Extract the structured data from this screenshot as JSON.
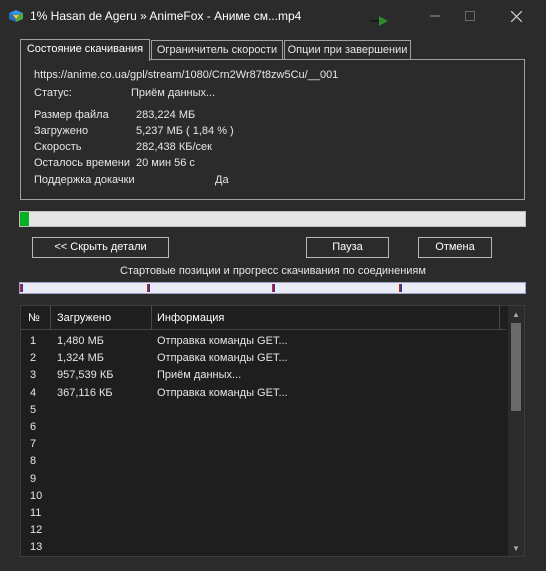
{
  "window": {
    "title": "1% Hasan de Ageru » AnimeFox - Аниме см...mp4",
    "minimize_icon": "minimize-icon",
    "maximize_icon": "maximize-icon",
    "close_icon": "close-icon"
  },
  "tabs": [
    {
      "label": "Состояние скачивания",
      "active": true
    },
    {
      "label": "Ограничитель скорости",
      "active": false
    },
    {
      "label": "Опции при завершении",
      "active": false
    }
  ],
  "details": {
    "url": "https://anime.co.ua/gpl/stream/1080/Crn2Wr87t8zw5Cu/__001",
    "status_label": "Статус:",
    "status_value": "Приём данных...",
    "file_size_label": "Размер файла",
    "file_size_value": "283,224  МБ",
    "downloaded_label": "Загружено",
    "downloaded_value": "5,237  МБ  ( 1,84 % )",
    "speed_label": "Скорость",
    "speed_value": "282,438  КБ/сек",
    "time_left_label": "Осталось времени",
    "time_left_value": "20 мин 56 с",
    "resume_label": "Поддержка докачки",
    "resume_value": "Да"
  },
  "progress": {
    "percent": 1.84,
    "fill_color": "#06b025"
  },
  "buttons": {
    "hide_details": "<< Скрыть детали",
    "pause": "Пауза",
    "cancel": "Отмена"
  },
  "connections": {
    "caption": "Стартовые позиции и прогресс скачивания по соединениям",
    "marker_color": "#cc2222"
  },
  "table": {
    "headers": [
      "№",
      "Загружено",
      "Информация"
    ],
    "rows": [
      {
        "n": "1",
        "downloaded": "1,480  МБ",
        "info": "Отправка команды GET..."
      },
      {
        "n": "2",
        "downloaded": "1,324  МБ",
        "info": "Отправка команды GET..."
      },
      {
        "n": "3",
        "downloaded": "957,539  КБ",
        "info": "Приём данных..."
      },
      {
        "n": "4",
        "downloaded": "367,116  КБ",
        "info": "Отправка команды GET..."
      },
      {
        "n": "5",
        "downloaded": "",
        "info": ""
      },
      {
        "n": "6",
        "downloaded": "",
        "info": ""
      },
      {
        "n": "7",
        "downloaded": "",
        "info": ""
      },
      {
        "n": "8",
        "downloaded": "",
        "info": ""
      },
      {
        "n": "9",
        "downloaded": "",
        "info": ""
      },
      {
        "n": "10",
        "downloaded": "",
        "info": ""
      },
      {
        "n": "11",
        "downloaded": "",
        "info": ""
      },
      {
        "n": "12",
        "downloaded": "",
        "info": ""
      },
      {
        "n": "13",
        "downloaded": "",
        "info": ""
      }
    ]
  }
}
